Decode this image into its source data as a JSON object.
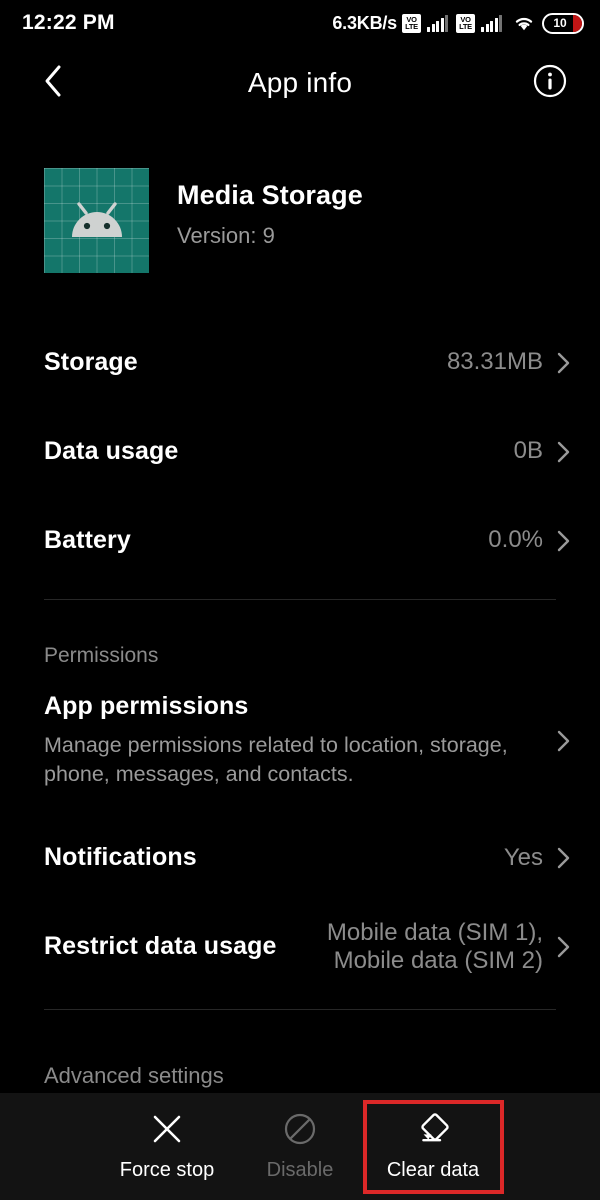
{
  "status_bar": {
    "clock": "12:22 PM",
    "network_speed": "6.3KB/s",
    "volte_top": "VO",
    "volte_bottom": "LTE",
    "sim_count": 2,
    "wifi_icon": "wifi-icon",
    "battery_level": "10"
  },
  "app_bar": {
    "back_icon": "chevron-left-icon",
    "title": "App info",
    "info_icon": "info-circle-icon"
  },
  "app": {
    "icon_name": "android-media-storage-icon",
    "name": "Media Storage",
    "version_label": "Version: 9",
    "icon_color": "#14766a"
  },
  "usage_rows": [
    {
      "label": "Storage",
      "value": "83.31MB",
      "chevron": "chevron-right-icon"
    },
    {
      "label": "Data usage",
      "value": "0B",
      "chevron": "chevron-right-icon"
    },
    {
      "label": "Battery",
      "value": "0.0%",
      "chevron": "chevron-right-icon"
    }
  ],
  "permissions": {
    "section_label": "Permissions",
    "app_permissions": {
      "label": "App permissions",
      "description": "Manage permissions related to location, storage, phone, messages, and contacts.",
      "chevron": "chevron-right-icon"
    },
    "notifications": {
      "label": "Notifications",
      "value": "Yes",
      "chevron": "chevron-right-icon"
    },
    "restrict_data_usage": {
      "label": "Restrict data usage",
      "value_line1": "Mobile data (SIM 1),",
      "value_line2": "Mobile data (SIM 2)",
      "chevron": "chevron-right-icon"
    }
  },
  "advanced": {
    "section_label": "Advanced settings"
  },
  "action_bar": {
    "actions": [
      {
        "label": "Force stop",
        "icon": "close-x-icon",
        "enabled": true,
        "highlighted": false
      },
      {
        "label": "Disable",
        "icon": "block-circle-icon",
        "enabled": false,
        "highlighted": false
      },
      {
        "label": "Clear data",
        "icon": "eraser-icon",
        "enabled": true,
        "highlighted": true
      }
    ],
    "highlight_color": "#dc2828"
  }
}
